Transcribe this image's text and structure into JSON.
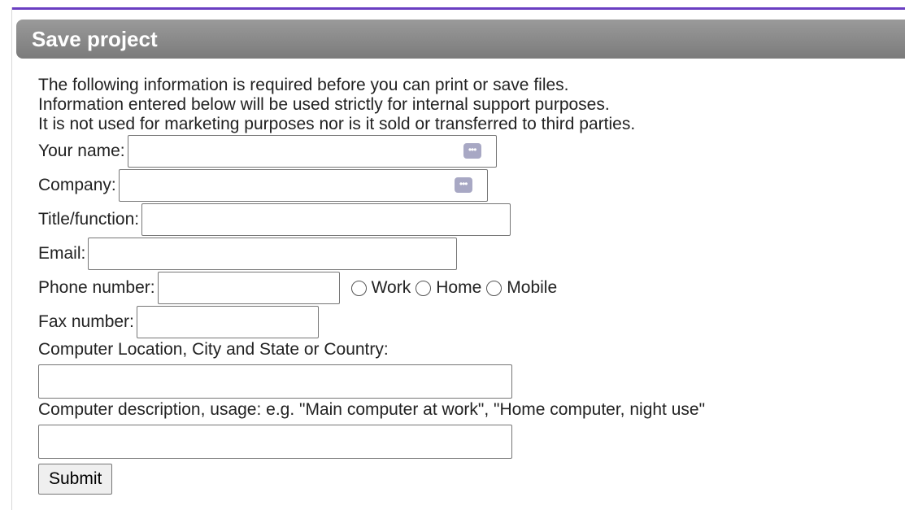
{
  "panel": {
    "title": "Save project",
    "accent_color": "#6a3ec2",
    "header_color": "#8a8a8a"
  },
  "intro": {
    "line1": "The following information is required before you can print or save files.",
    "line2": "Information entered below will be used strictly for internal support purposes.",
    "line3": "It is not used for marketing purposes nor is it sold or transferred to third parties."
  },
  "form": {
    "name_label": "Your name:",
    "name_value": "",
    "company_label": "Company:",
    "company_value": "",
    "title_label": "Title/function:",
    "title_value": "",
    "email_label": "Email:",
    "email_value": "",
    "phone_label": "Phone number:",
    "phone_value": "",
    "phone_types": [
      "Work",
      "Home",
      "Mobile"
    ],
    "fax_label": "Fax number:",
    "fax_value": "",
    "location_label": "Computer Location, City and State or Country:",
    "location_value": "",
    "description_label": "Computer description, usage: e.g. \"Main computer at work\", \"Home computer, night use\"",
    "description_value": "",
    "autofill_icon": "autofill-icon",
    "submit_label": "Submit"
  }
}
